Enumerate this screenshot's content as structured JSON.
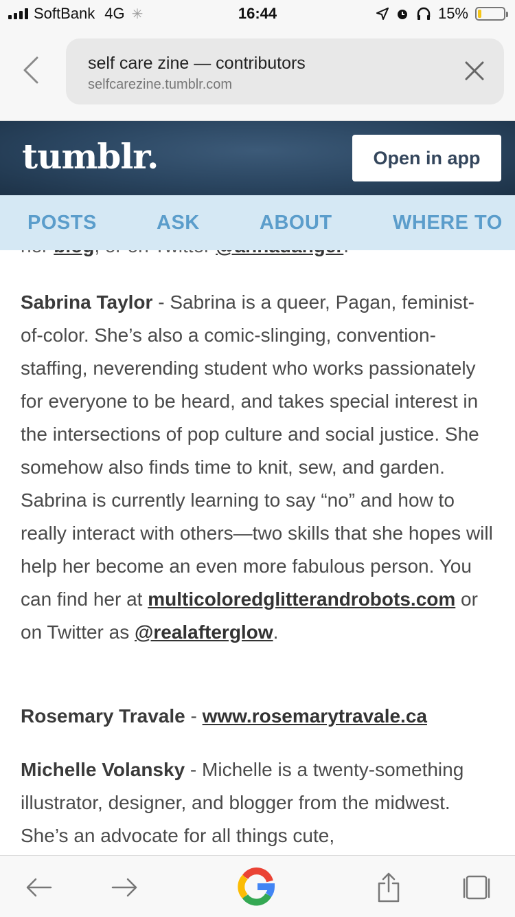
{
  "status_bar": {
    "carrier": "SoftBank",
    "network": "4G",
    "time": "16:44",
    "battery": "15%",
    "battery_level": 0.15
  },
  "address_bar": {
    "page_title": "self care zine — contributors",
    "domain": "selfcarezine.tumblr.com"
  },
  "tumblr_header": {
    "logo": "tumblr.",
    "open_app_label": "Open in app",
    "bg_color": "#2a4560"
  },
  "nav": {
    "tabs": [
      {
        "label": "POSTS"
      },
      {
        "label": "ASK"
      },
      {
        "label": "ABOUT"
      },
      {
        "label": "WHERE TO"
      }
    ],
    "color": "#5b9dcb"
  },
  "content": {
    "cut_line": {
      "prefix": "her ",
      "blog_link": "blog",
      "middle": ", or on Twitter ",
      "twitter_link": "@annadanger",
      "suffix": "."
    },
    "entries": [
      {
        "name": "Sabrina Taylor",
        "separator": " - ",
        "bio": "Sabrina is a queer, Pagan, feminist-of-color.  She’s also a comic-slinging, convention-staffing, neverending student who works passionately for everyone to be heard, and takes special interest in the intersections of pop culture and social justice. She somehow also finds time to knit, sew, and garden. Sabrina is currently learning to say “no” and how to really interact with others—two skills that she hopes will help her become an even more fabulous person. You can find her at ",
        "link1": "multicoloredglitterandrobots.com",
        "mid": " or on Twitter as ",
        "link2": "@realafterglow",
        "end": "."
      },
      {
        "name": "Rosemary Travale",
        "separator": " - ",
        "link1": "www.rosemarytravale.ca"
      },
      {
        "name": "Michelle Volansky",
        "separator": " - ",
        "bio": "Michelle is a twenty-something illustrator, designer, and blogger from the midwest. She’s an advocate for all things cute,"
      }
    ]
  },
  "toolbar": {
    "icons": [
      "back-arrow-icon",
      "forward-arrow-icon",
      "google-icon",
      "share-icon",
      "tabs-icon"
    ]
  }
}
